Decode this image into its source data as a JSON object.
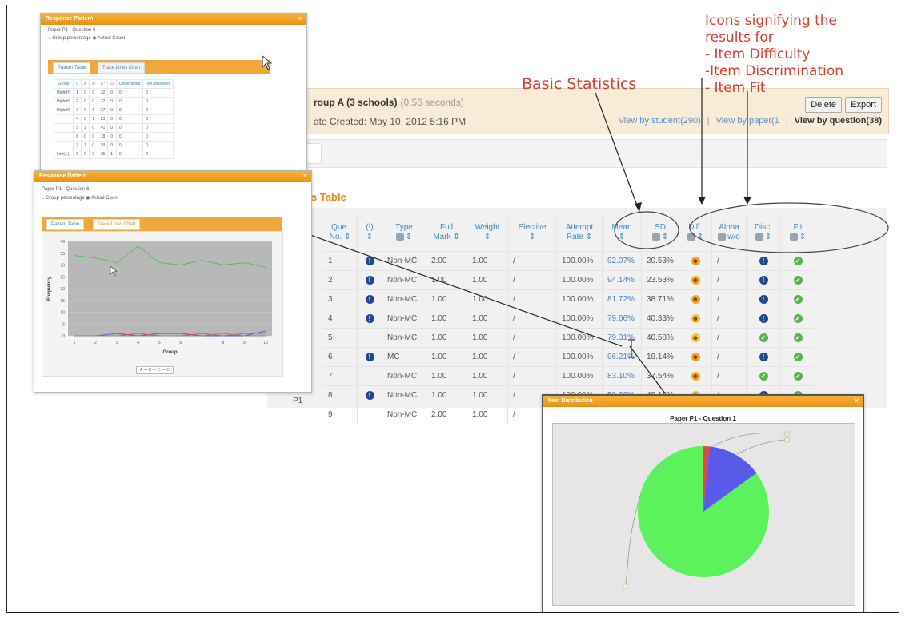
{
  "report": {
    "title": "roup A (3 schools)",
    "elapsed": "(0.56 seconds)",
    "date_created": "ate Created: May 10, 2012 5:16 PM",
    "view_by_student": "View by student(290)",
    "view_by_paper": "View by paper(1",
    "view_by_question": "View by question(38)",
    "delete_label": "Delete",
    "export_label": "Export",
    "section_title": "s Table"
  },
  "annotations": {
    "basic_statistics": "Basic Statistics",
    "icons_text": [
      "Icons signifying the",
      "results for",
      "- Item Difficulty",
      "-Item Discrimination",
      "- Item Fit"
    ]
  },
  "table": {
    "headers": [
      {
        "l1": "Que.",
        "l2": "No. ⇕"
      },
      {
        "l1": "(!)",
        "l2": "⇕"
      },
      {
        "l1": "Type",
        "l2": "⇕"
      },
      {
        "l1": "Full",
        "l2": "Mark ⇕"
      },
      {
        "l1": "Weight",
        "l2": "⇕"
      },
      {
        "l1": "Elective",
        "l2": "⇕"
      },
      {
        "l1": "Attempt",
        "l2": "Rate ⇕"
      },
      {
        "l1": "Mean",
        "l2": "⇕"
      },
      {
        "l1": "SD",
        "l2": "⇕"
      },
      {
        "l1": "Diff.",
        "l2": "⇕"
      },
      {
        "l1": "Alpha",
        "l2": "w/o"
      },
      {
        "l1": "Disc.",
        "l2": "⇕"
      },
      {
        "l1": "Fit",
        "l2": "⇕"
      }
    ],
    "rows": [
      {
        "no": "1",
        "flag": "info",
        "type": "Non-MC",
        "full": "2.00",
        "weight": "1.00",
        "elective": "/",
        "attempt": "100.00%",
        "mean": "92.07%",
        "sd": "20.53%",
        "diff": "face",
        "alpha": "/",
        "disc": "info",
        "fit": "ok"
      },
      {
        "no": "2",
        "flag": "info",
        "type": "Non-MC",
        "full": "1.00",
        "weight": "1.00",
        "elective": "/",
        "attempt": "100.00%",
        "mean": "94.14%",
        "sd": "23.53%",
        "diff": "face",
        "alpha": "/",
        "disc": "info",
        "fit": "ok"
      },
      {
        "no": "3",
        "flag": "info",
        "type": "Non-MC",
        "full": "1.00",
        "weight": "1.00",
        "elective": "/",
        "attempt": "100.00%",
        "mean": "81.72%",
        "sd": "38.71%",
        "diff": "face",
        "alpha": "/",
        "disc": "info",
        "fit": "ok"
      },
      {
        "no": "4",
        "flag": "info",
        "type": "Non-MC",
        "full": "1.00",
        "weight": "1.00",
        "elective": "/",
        "attempt": "100.00%",
        "mean": "79.66%",
        "sd": "40.33%",
        "diff": "face-y",
        "alpha": "/",
        "disc": "info",
        "fit": "ok"
      },
      {
        "no": "5",
        "flag": "",
        "type": "Non-MC",
        "full": "1.00",
        "weight": "1.00",
        "elective": "/",
        "attempt": "100.00%",
        "mean": "79.31%",
        "sd": "40.58%",
        "diff": "face-y",
        "alpha": "/",
        "disc": "ok",
        "fit": "ok"
      },
      {
        "no": "6",
        "flag": "info",
        "type": "MC",
        "full": "1.00",
        "weight": "1.00",
        "elective": "/",
        "attempt": "100.00%",
        "mean": "96.21%",
        "sd": "19.14%",
        "diff": "face",
        "alpha": "/",
        "disc": "info",
        "fit": "ok"
      },
      {
        "no": "7",
        "flag": "",
        "type": "Non-MC",
        "full": "1.00",
        "weight": "1.00",
        "elective": "/",
        "attempt": "100.00%",
        "mean": "83.10%",
        "sd": "37.54%",
        "diff": "face",
        "alpha": "/",
        "disc": "ok",
        "fit": "ok"
      },
      {
        "no": "8",
        "flag": "info",
        "type": "Non-MC",
        "full": "1.00",
        "weight": "1.00",
        "elective": "/",
        "attempt": "100.00%",
        "mean": "59.66%",
        "sd": "49.14%",
        "diff": "face-y",
        "alpha": "/",
        "disc": "info",
        "fit": "ok"
      },
      {
        "no": "9",
        "flag": "",
        "type": "Non-MC",
        "full": "2.00",
        "weight": "1.00",
        "elective": "/",
        "attempt": "",
        "mean": "",
        "sd": "",
        "diff": "",
        "alpha": "",
        "disc": "",
        "fit": ""
      }
    ],
    "paper_label": "P1"
  },
  "popup_top": {
    "title": "Response Pattern",
    "paper_question": "Paper P1 - Question 6",
    "radio_group": "Group percentage",
    "radio_actual": "Actual Count",
    "tab_pattern": "Pattern Table",
    "tab_trace": "Trace Lines Chart",
    "columns": [
      "Group",
      "0",
      "A",
      "B",
      "C*",
      "D",
      "Unidentified",
      "Not Answered"
    ],
    "rows": [
      [
        "High(H)",
        "1",
        "0",
        "0",
        "32",
        "0",
        "0",
        "0"
      ],
      [
        "High(H)",
        "2",
        "0",
        "0",
        "32",
        "0",
        "0",
        "0"
      ],
      [
        "High(H)",
        "3",
        "0",
        "1",
        "27",
        "0",
        "0",
        "0"
      ],
      [
        "",
        "4",
        "0",
        "1",
        "23",
        "0",
        "0",
        "0"
      ],
      [
        "",
        "5",
        "1",
        "0",
        "41",
        "0",
        "0",
        "0"
      ],
      [
        "",
        "6",
        "0",
        "0",
        "18",
        "0",
        "0",
        "0"
      ],
      [
        "",
        "7",
        "1",
        "0",
        "30",
        "0",
        "0",
        "0"
      ],
      [
        "Low(L)",
        "8",
        "0",
        "0",
        "25",
        "1",
        "0",
        "0"
      ]
    ]
  },
  "popup_mid": {
    "title": "Response Pattern",
    "paper_question": "Paper P1 - Question 6",
    "radio_group": "Group percentage",
    "radio_actual": "Actual Count",
    "tab_pattern": "Pattern Table",
    "tab_trace": "Trace Lines Chart",
    "chart_data": {
      "type": "line",
      "xlabel": "Group",
      "ylabel": "Frequency",
      "x": [
        1,
        2,
        3,
        4,
        5,
        6,
        7,
        8,
        9,
        10
      ],
      "ylim": [
        0,
        40
      ],
      "yticks": [
        "0",
        "5",
        "10",
        "15",
        "20",
        "25",
        "30",
        "35",
        "40"
      ],
      "series": [
        {
          "name": "A",
          "color": "#4a56d8",
          "values": [
            0,
            0,
            1,
            0,
            1,
            1,
            0,
            0,
            0,
            2
          ]
        },
        {
          "name": "B",
          "color": "#e05656",
          "values": [
            0,
            0,
            0,
            1,
            0,
            0,
            1,
            0,
            1,
            1
          ]
        },
        {
          "name": "C",
          "color": "#47c24d",
          "values": [
            34,
            33,
            31,
            38,
            31,
            30,
            32,
            30,
            31,
            29
          ]
        },
        {
          "name": "D",
          "color": "#888888",
          "values": [
            0,
            0,
            0,
            0,
            0,
            0,
            0,
            1,
            0,
            0
          ]
        }
      ]
    }
  },
  "popup_pie": {
    "title": "Item Distribution",
    "chart_data": {
      "type": "pie",
      "title": "Paper P1 - Question 1",
      "slices": [
        {
          "color": "#5cf25c",
          "value": 85
        },
        {
          "color": "#e04848",
          "value": 1.5
        },
        {
          "color": "#5a5ae8",
          "value": 13.5
        }
      ]
    }
  }
}
